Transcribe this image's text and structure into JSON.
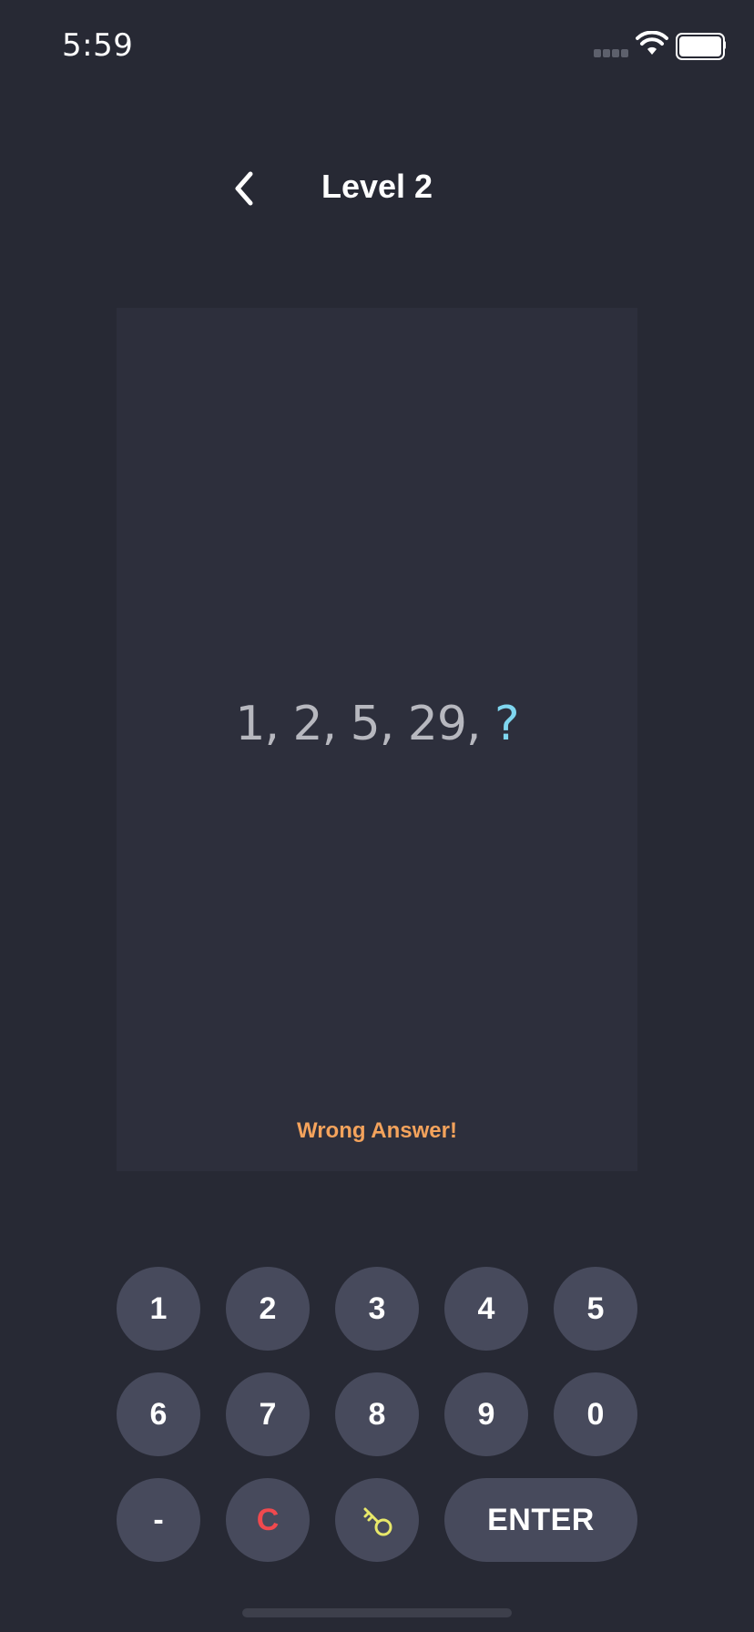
{
  "status_bar": {
    "time": "5:59"
  },
  "header": {
    "title": "Level 2"
  },
  "puzzle": {
    "sequence_text": "1, 2, 5, 29, ",
    "unknown": "?",
    "feedback": "Wrong Answer!"
  },
  "keypad": {
    "row1": [
      "1",
      "2",
      "3",
      "4",
      "5"
    ],
    "row2": [
      "6",
      "7",
      "8",
      "9",
      "0"
    ],
    "minus": "-",
    "clear": "C",
    "hint_icon": "key-icon",
    "enter": "ENTER"
  },
  "colors": {
    "background": "#272934",
    "card": "#2d2f3c",
    "key": "#474a5c",
    "question_mark": "#7fd6ef",
    "feedback": "#f4a35c",
    "clear": "#f0494e",
    "hint": "#e8e86a"
  }
}
